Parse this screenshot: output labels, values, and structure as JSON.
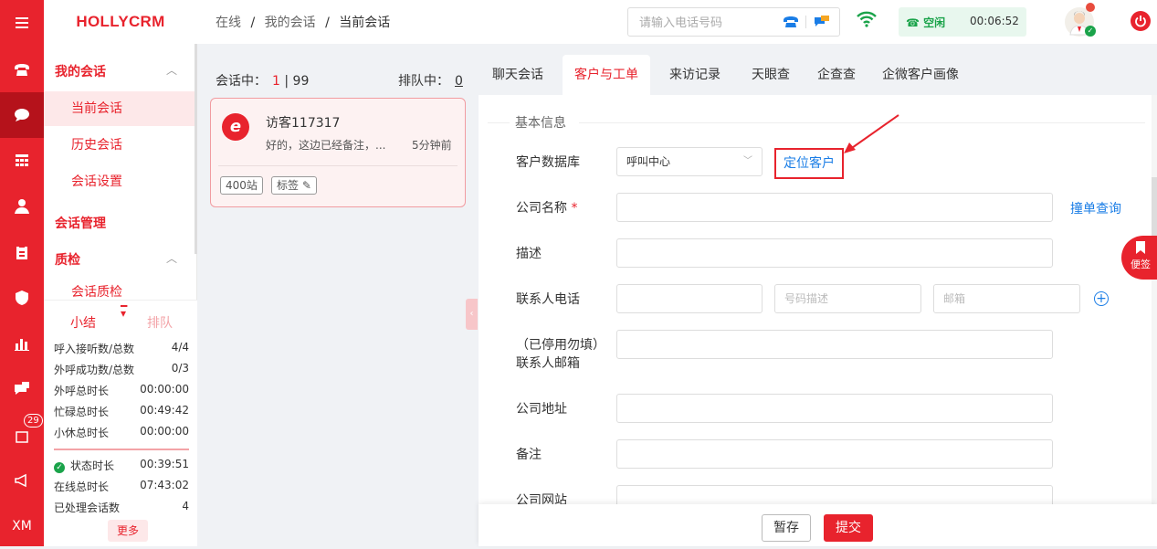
{
  "app": {
    "logo": "HOLLYCRM",
    "rail_user": "XM",
    "rail_badge": "29"
  },
  "breadcrumb": {
    "a": "在线",
    "b": "我的会话",
    "c": "当前会话",
    "sep": "/"
  },
  "topbar": {
    "phone_placeholder": "请输入电话号码",
    "status": "☎ 空闲",
    "timer": "00:06:52"
  },
  "sidebar": {
    "group_my": "我的会话",
    "current": "当前会话",
    "history": "历史会话",
    "settings": "会话设置",
    "group_manage": "会话管理",
    "group_qc": "质检",
    "qc_sub": "会话质检"
  },
  "stats": {
    "tab_summary": "小结",
    "tab_queue": "排队",
    "rows": [
      {
        "k": "呼入接听数/总数",
        "v": "4/4"
      },
      {
        "k": "外呼成功数/总数",
        "v": "0/3"
      },
      {
        "k": "外呼总时长",
        "v": "00:00:00"
      },
      {
        "k": "忙碌总时长",
        "v": "00:49:42"
      },
      {
        "k": "小休总时长",
        "v": "00:00:00"
      },
      {
        "k": "状态时长",
        "v": "00:39:51"
      },
      {
        "k": "在线总时长",
        "v": "07:43:02"
      },
      {
        "k": "已处理会话数",
        "v": "4"
      }
    ],
    "more": "更多"
  },
  "sessions": {
    "label": "会话中：",
    "active": "1",
    "total": "| 99",
    "queue_label": "排队中：",
    "queue": "0",
    "card": {
      "icon": "e",
      "name": "访客117317",
      "msg": "好的，这边已经备注，...",
      "time": "5分钟前",
      "tag1": "400站",
      "tag2": "标签 ✎"
    }
  },
  "tabs": [
    "聊天会话",
    "客户与工单",
    "来访记录",
    "天眼查",
    "企查查",
    "企微客户画像"
  ],
  "form": {
    "section": "基本信息",
    "db_label": "客户数据库",
    "db_value": "呼叫中心",
    "locate": "定位客户",
    "company_label": "公司名称",
    "required": "*",
    "dup_link": "撞单查询",
    "desc_label": "描述",
    "phone_label": "联系人电话",
    "phone_desc_ph": "号码描述",
    "email_ph": "邮箱",
    "email_label_1": "（已停用勿填）",
    "email_label_2": "联系人邮箱",
    "address_label": "公司地址",
    "note_label": "备注",
    "website_label": "公司网站"
  },
  "footer": {
    "draft": "暂存",
    "submit": "提交"
  },
  "sticky": "便签",
  "colors": {
    "brand": "#e8232d",
    "link": "#1a7de6",
    "status_green": "#1aa34a"
  }
}
